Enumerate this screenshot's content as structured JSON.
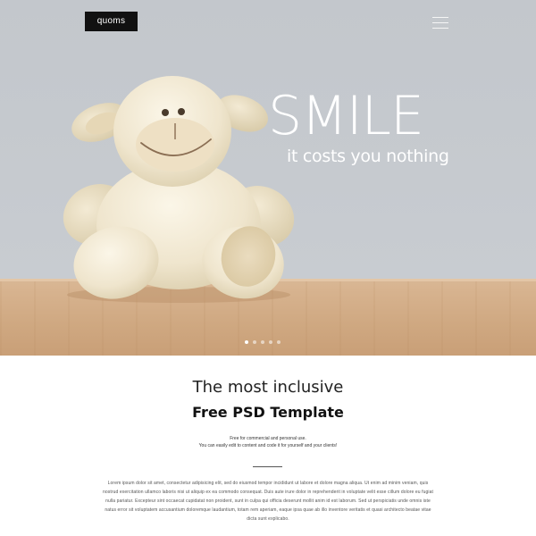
{
  "brand": {
    "logo_text": "quoms"
  },
  "header": {
    "menu_icon": "hamburger-menu-icon"
  },
  "hero": {
    "headline": "SMILE",
    "subheadline": "it costs you nothing",
    "slider": {
      "total_slides": 5,
      "active_index": 0
    }
  },
  "intro": {
    "line1": "The most inclusive",
    "line2": "Free PSD Template",
    "small_line1": "Free for commercial and personal use.",
    "small_line2": "You can easily edit to content and code it for yourself and your clients!",
    "body": "Lorem ipsum dolor sit amet, consectetur adipisicing elit, sed do eiusmod tempor incididunt ut labore et dolore magna aliqua. Ut enim ad minim veniam, quis nostrud exercitation ullamco laboris nisi ut aliquip ex ea commodo consequat. Duis aute irure dolor in reprehenderit in voluptate velit esse cillum dolore eu fugiat nulla pariatur. Excepteur sint occaecat cupidatat non proident, sunt in culpa qui officia deserunt mollit anim id est laborum. Sed ut perspiciatis unde omnis iste natus error sit voluptatem accusantium doloremque laudantium, totam rem aperiam, eaque ipsa quae ab illo inventore veritatis et quasi architecto beatae vitae dicta sunt explicabo."
  },
  "colors": {
    "hero_wall": "#c6cacf",
    "shelf_wood": "#d3ad87",
    "logo_bg": "#111111",
    "text_dark": "#222222"
  }
}
